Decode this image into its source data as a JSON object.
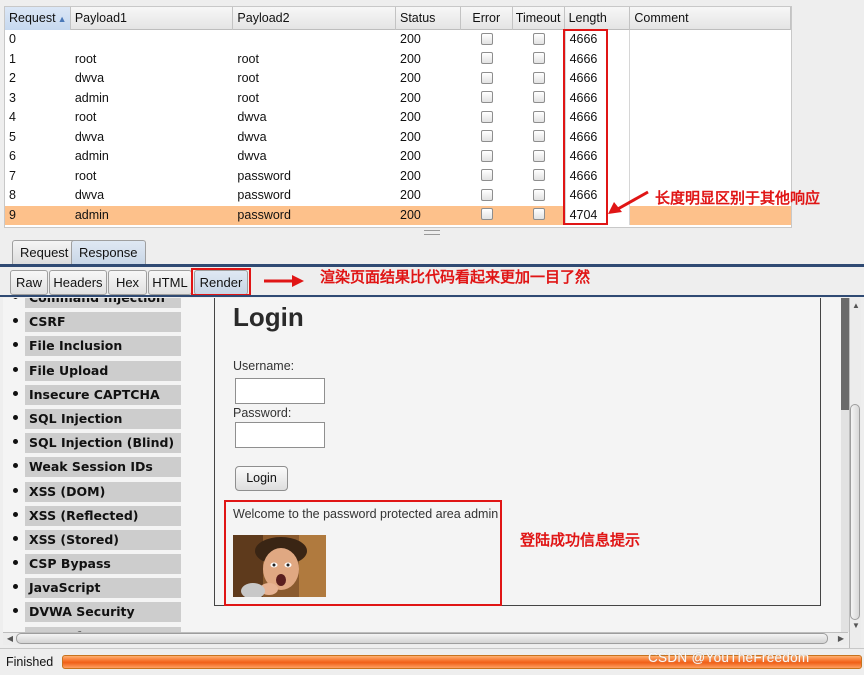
{
  "results": {
    "columns": [
      "Request",
      "Payload1",
      "Payload2",
      "Status",
      "Error",
      "Timeout",
      "Length",
      "Comment"
    ],
    "sort_indicator": "▲",
    "rows": [
      {
        "request": "0",
        "payload1": "",
        "payload2": "",
        "status": "200",
        "error": false,
        "timeout": false,
        "length": "4666",
        "comment": ""
      },
      {
        "request": "1",
        "payload1": "root",
        "payload2": "root",
        "status": "200",
        "error": false,
        "timeout": false,
        "length": "4666",
        "comment": ""
      },
      {
        "request": "2",
        "payload1": "dwva",
        "payload2": "root",
        "status": "200",
        "error": false,
        "timeout": false,
        "length": "4666",
        "comment": ""
      },
      {
        "request": "3",
        "payload1": "admin",
        "payload2": "root",
        "status": "200",
        "error": false,
        "timeout": false,
        "length": "4666",
        "comment": ""
      },
      {
        "request": "4",
        "payload1": "root",
        "payload2": "dwva",
        "status": "200",
        "error": false,
        "timeout": false,
        "length": "4666",
        "comment": ""
      },
      {
        "request": "5",
        "payload1": "dwva",
        "payload2": "dwva",
        "status": "200",
        "error": false,
        "timeout": false,
        "length": "4666",
        "comment": ""
      },
      {
        "request": "6",
        "payload1": "admin",
        "payload2": "dwva",
        "status": "200",
        "error": false,
        "timeout": false,
        "length": "4666",
        "comment": ""
      },
      {
        "request": "7",
        "payload1": "root",
        "payload2": "password",
        "status": "200",
        "error": false,
        "timeout": false,
        "length": "4666",
        "comment": ""
      },
      {
        "request": "8",
        "payload1": "dwva",
        "payload2": "password",
        "status": "200",
        "error": false,
        "timeout": false,
        "length": "4666",
        "comment": ""
      },
      {
        "request": "9",
        "payload1": "admin",
        "payload2": "password",
        "status": "200",
        "error": false,
        "timeout": false,
        "length": "4704",
        "comment": "",
        "selected": true
      }
    ]
  },
  "tabs": {
    "request": "Request",
    "response": "Response"
  },
  "view_tabs": [
    "Raw",
    "Headers",
    "Hex",
    "HTML",
    "Render"
  ],
  "annotations": {
    "length_note": "长度明显区别于其他响应",
    "render_note": "渲染页面结果比代码看起来更加一目了然",
    "success_note": "登陆成功信息提示"
  },
  "render_page": {
    "menu_items": [
      "Command Injection",
      "CSRF",
      "File Inclusion",
      "File Upload",
      "Insecure CAPTCHA",
      "SQL Injection",
      "SQL Injection (Blind)",
      "Weak Session IDs",
      "XSS (DOM)",
      "XSS (Reflected)",
      "XSS (Stored)",
      "CSP Bypass",
      "JavaScript",
      "DVWA Security",
      "PHP Info"
    ],
    "title": "Login",
    "username_label": "Username:",
    "password_label": "Password:",
    "login_button": "Login",
    "welcome": "Welcome to the password protected area admin"
  },
  "status": {
    "text": "Finished",
    "progress": 1.0
  },
  "watermark": "CSDN @YouTheFreedom",
  "colors": {
    "annotation": "#e01515",
    "selected_row": "#fdc18b",
    "progress": "#f46a22",
    "tab_line": "#2f4a73"
  }
}
